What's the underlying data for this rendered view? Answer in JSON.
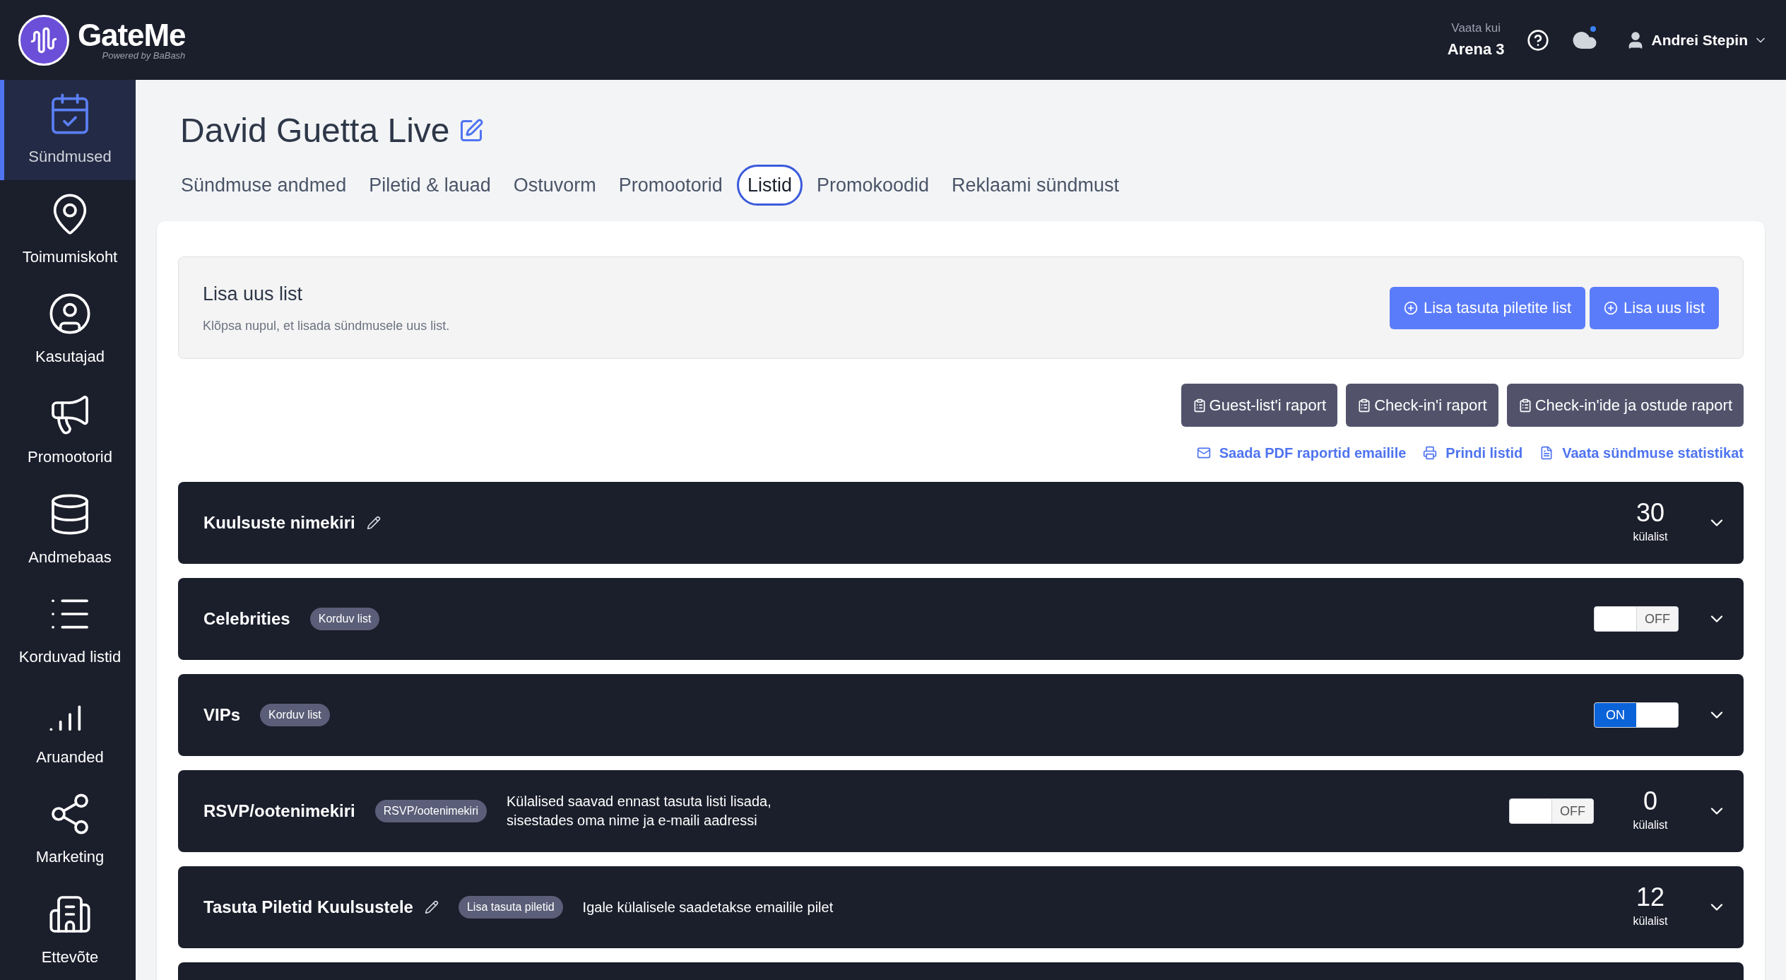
{
  "brand": {
    "name": "GateMe",
    "tagline": "Powered by BaBash"
  },
  "header": {
    "view_as_label": "Vaata kui",
    "view_as_value": "Arena 3",
    "notification_dot": true,
    "user": "Andrei Stepin"
  },
  "sidebar": {
    "items": [
      {
        "label": "Sündmused",
        "selected": true
      },
      {
        "label": "Toimumiskoht",
        "selected": false
      },
      {
        "label": "Kasutajad",
        "selected": false
      },
      {
        "label": "Promootorid",
        "selected": false
      },
      {
        "label": "Andmebaas",
        "selected": false
      },
      {
        "label": "Korduvad listid",
        "selected": false
      },
      {
        "label": "Aruanded",
        "selected": false
      },
      {
        "label": "Marketing",
        "selected": false
      },
      {
        "label": "Ettevõte",
        "selected": false
      }
    ]
  },
  "page": {
    "title": "David Guetta Live"
  },
  "tabs": [
    {
      "label": "Sündmuse andmed",
      "selected": false
    },
    {
      "label": "Piletid & lauad",
      "selected": false
    },
    {
      "label": "Ostuvorm",
      "selected": false
    },
    {
      "label": "Promootorid",
      "selected": false
    },
    {
      "label": "Listid",
      "selected": true
    },
    {
      "label": "Promokoodid",
      "selected": false
    },
    {
      "label": "Reklaami sündmust",
      "selected": false
    }
  ],
  "add_panel": {
    "title": "Lisa uus list",
    "hint": "Klõpsa nupul, et lisada sündmusele uus list.",
    "buttons": [
      "Lisa tasuta piletite list",
      "Lisa uus list"
    ]
  },
  "report_buttons": [
    "Guest-list'i raport",
    "Check-in'i raport",
    "Check-in'ide ja ostude raport"
  ],
  "links": [
    {
      "kind": "mail",
      "label": "Saada PDF raportid emailile"
    },
    {
      "kind": "print",
      "label": "Prindi listid"
    },
    {
      "kind": "stats",
      "label": "Vaata sündmuse statistikat"
    }
  ],
  "lists": [
    {
      "title": "Kuulsuste nimekiri",
      "editable": true,
      "count": "30",
      "count_label": "külalist"
    },
    {
      "title": "Celebrities",
      "editable": false,
      "badge": "Korduv list",
      "toggle": {
        "on": false,
        "label": "OFF"
      }
    },
    {
      "title": "VIPs",
      "editable": false,
      "badge": "Korduv list",
      "toggle": {
        "on": true,
        "label": "ON"
      }
    },
    {
      "title": "RSVP/ootenimekiri",
      "editable": false,
      "badge": "RSVP/ootenimekiri",
      "description": "Külalised saavad ennast tasuta listi lisada,\nsisestades oma nime ja e-maili aadressi",
      "toggle": {
        "on": false,
        "label": "OFF"
      },
      "count": "0",
      "count_label": "külalist"
    },
    {
      "title": "Tasuta Piletid Kuulsustele",
      "editable": true,
      "badge": "Lisa tasuta piletid",
      "description": "Igale külalisele saadetakse emailile pilet",
      "count": "12",
      "count_label": "külalist"
    }
  ]
}
